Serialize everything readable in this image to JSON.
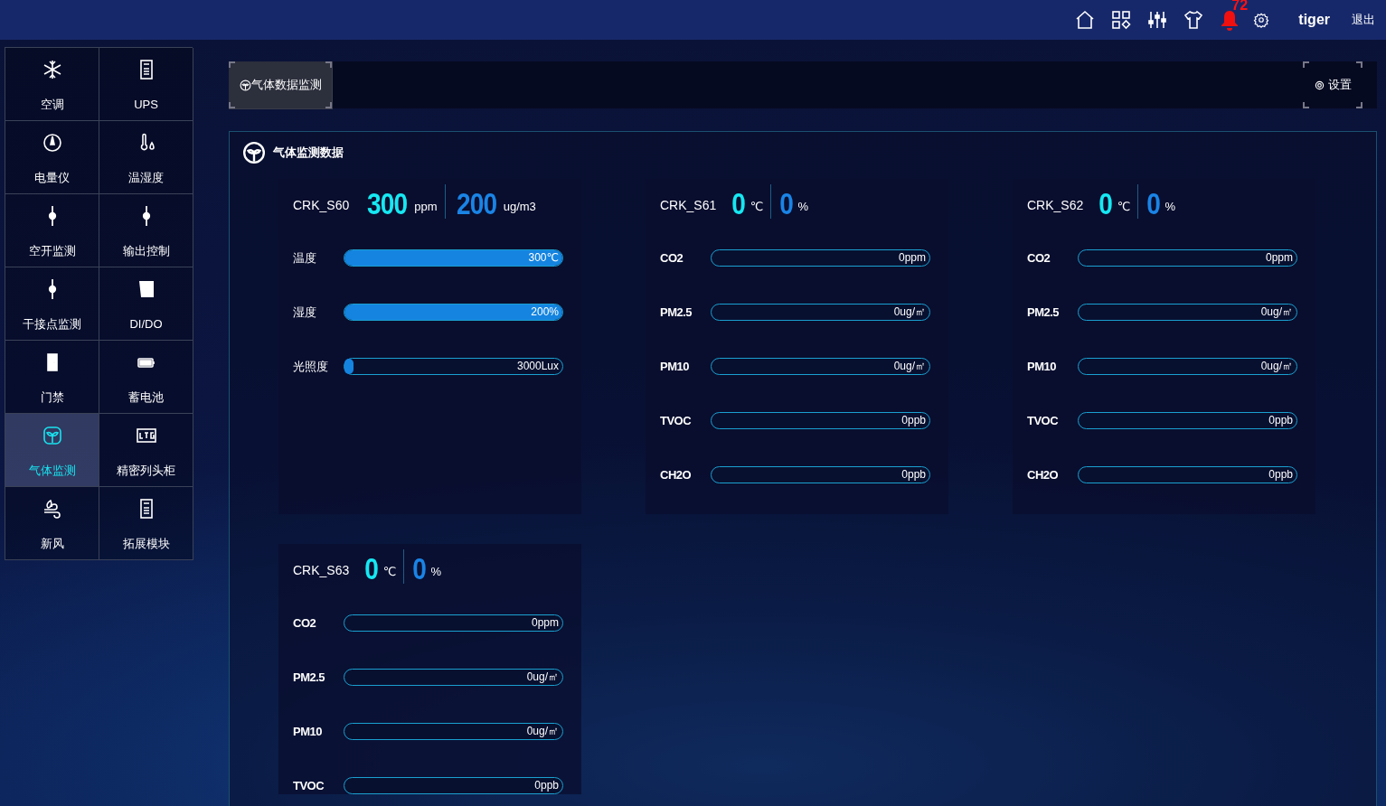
{
  "topbar": {
    "alarm_count": "72",
    "user": "tiger",
    "logout": "退出"
  },
  "sidebar": {
    "items": [
      {
        "label": "空调",
        "selected": false
      },
      {
        "label": "UPS",
        "selected": false
      },
      {
        "label": "电量仪",
        "selected": false
      },
      {
        "label": "温湿度",
        "selected": false
      },
      {
        "label": "空开监测",
        "selected": false
      },
      {
        "label": "输出控制",
        "selected": false
      },
      {
        "label": "干接点监测",
        "selected": false
      },
      {
        "label": "DI/DO",
        "selected": false
      },
      {
        "label": "门禁",
        "selected": false
      },
      {
        "label": "蓄电池",
        "selected": false
      },
      {
        "label": "气体监测",
        "selected": true
      },
      {
        "label": "精密列头柜",
        "selected": false
      },
      {
        "label": "新风",
        "selected": false
      },
      {
        "label": "拓展模块",
        "selected": false
      }
    ]
  },
  "tabs": [
    {
      "label": "气体数据监测",
      "selected": true
    }
  ],
  "settings_button": "设置",
  "panel": {
    "title": "气体监测数据",
    "sensors": [
      {
        "kind": "environment",
        "name": "CRK_S60",
        "readings": [
          {
            "value": "300",
            "unit": "ppm"
          },
          {
            "value": "200",
            "unit": "ug/m3"
          }
        ],
        "rows": [
          {
            "label": "温度",
            "level": 1,
            "reading": "300℃"
          },
          {
            "label": "湿度",
            "level": 1,
            "reading": "200%"
          },
          {
            "label": "光照度",
            "level": 0.03,
            "reading": "3000Lux"
          }
        ]
      },
      {
        "kind": "gas",
        "name": "CRK_S61",
        "readings": [
          {
            "value": "0",
            "unit": "℃"
          },
          {
            "value": "0",
            "unit": "%"
          }
        ],
        "rows": [
          {
            "label": "CO2",
            "reading": "0ppm"
          },
          {
            "label": "PM2.5",
            "reading": "0ug/㎡"
          },
          {
            "label": "PM10",
            "reading": "0ug/㎡"
          },
          {
            "label": "TVOC",
            "reading": "0ppb"
          },
          {
            "label": "CH2O",
            "reading": "0ppb"
          }
        ]
      },
      {
        "kind": "gas",
        "name": "CRK_S62",
        "readings": [
          {
            "value": "0",
            "unit": "℃"
          },
          {
            "value": "0",
            "unit": "%"
          }
        ],
        "rows": [
          {
            "label": "CO2",
            "reading": "0ppm"
          },
          {
            "label": "PM2.5",
            "reading": "0ug/㎡"
          },
          {
            "label": "PM10",
            "reading": "0ug/㎡"
          },
          {
            "label": "TVOC",
            "reading": "0ppb"
          },
          {
            "label": "CH2O",
            "reading": "0ppb"
          }
        ]
      },
      {
        "kind": "gas",
        "name": "CRK_S63",
        "readings": [
          {
            "value": "0",
            "unit": "℃"
          },
          {
            "value": "0",
            "unit": "%"
          }
        ],
        "rows": [
          {
            "label": "CO2",
            "reading": "0ppm"
          },
          {
            "label": "PM2.5",
            "reading": "0ug/㎡"
          },
          {
            "label": "PM10",
            "reading": "0ug/㎡"
          },
          {
            "label": "TVOC",
            "reading": "0ppb"
          }
        ]
      }
    ]
  }
}
